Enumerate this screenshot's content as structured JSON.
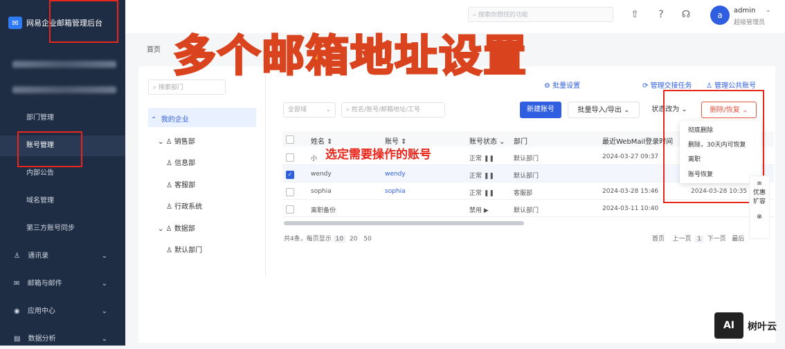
{
  "sidebar": {
    "brand": "网易企业邮箱管理后台",
    "items": [
      {
        "label": "部门管理"
      },
      {
        "label": "账号管理"
      },
      {
        "label": "内部公告"
      },
      {
        "label": "域名管理"
      },
      {
        "label": "第三方账号同步"
      }
    ],
    "groups": [
      {
        "label": "通讯录"
      },
      {
        "label": "邮箱与邮件"
      },
      {
        "label": "应用中心"
      },
      {
        "label": "数据分析"
      }
    ]
  },
  "topbar": {
    "search_placeholder": "搜索你想找的功能",
    "avatar_letter": "a",
    "user_name": "admin",
    "user_role": "超级管理员"
  },
  "breadcrumb": "首页",
  "overlay_title": "多个邮箱地址设置",
  "tree": {
    "search_placeholder": "搜索部门",
    "nodes": [
      {
        "label": "我的企业"
      },
      {
        "label": "销售部"
      },
      {
        "label": "信息部"
      },
      {
        "label": "客服部"
      },
      {
        "label": "行政系统"
      },
      {
        "label": "数据部"
      },
      {
        "label": "默认部门"
      }
    ]
  },
  "toolbar": {
    "links": [
      "批量设置",
      "管理交接任务",
      "管理公共账号"
    ],
    "domain_filter": "全部域",
    "search_placeholder": "姓名/账号/邮箱地址/工号",
    "new_account": "新建账号",
    "import_export": "批量导入/导出",
    "status_change": "状态改为",
    "delete_restore": "删除/恢复"
  },
  "table": {
    "headers": [
      "姓名",
      "账号",
      "账号状态",
      "部门",
      "最近WebMail登录时间"
    ],
    "rows": [
      {
        "name": "小",
        "account": "",
        "status": "正常",
        "dept": "默认部门",
        "last_login": "2024-03-27 09:37",
        "checked": false
      },
      {
        "name": "wendy",
        "account": "wendy",
        "status": "正常",
        "dept": "默认部门",
        "last_login": "",
        "checked": true
      },
      {
        "name": "sophia",
        "account": "sophia",
        "status": "正常",
        "dept": "客服部",
        "last_login": "2024-03-28 15:46",
        "checked": false
      },
      {
        "name": "离职备份",
        "account": "",
        "status": "禁用",
        "dept": "默认部门",
        "last_login": "2024-03-11 10:40",
        "checked": false
      }
    ],
    "extra_time": "2024-03-28 10:35"
  },
  "pagination": {
    "summary": "共4条，每页显示",
    "sizes": [
      "10",
      "20",
      "50"
    ],
    "first": "首页",
    "prev": "上一页",
    "current": "1",
    "next": "下一页",
    "last": "最后"
  },
  "callout": "选定需要操作的账号",
  "dropdown": {
    "items": [
      "彻底删除",
      "删除，30天内可恢复",
      "离职",
      "账号恢复"
    ]
  },
  "float_panel": {
    "label1": "优惠",
    "label2": "扩容"
  },
  "watermark": {
    "logo": "AI",
    "text": "树叶云"
  }
}
